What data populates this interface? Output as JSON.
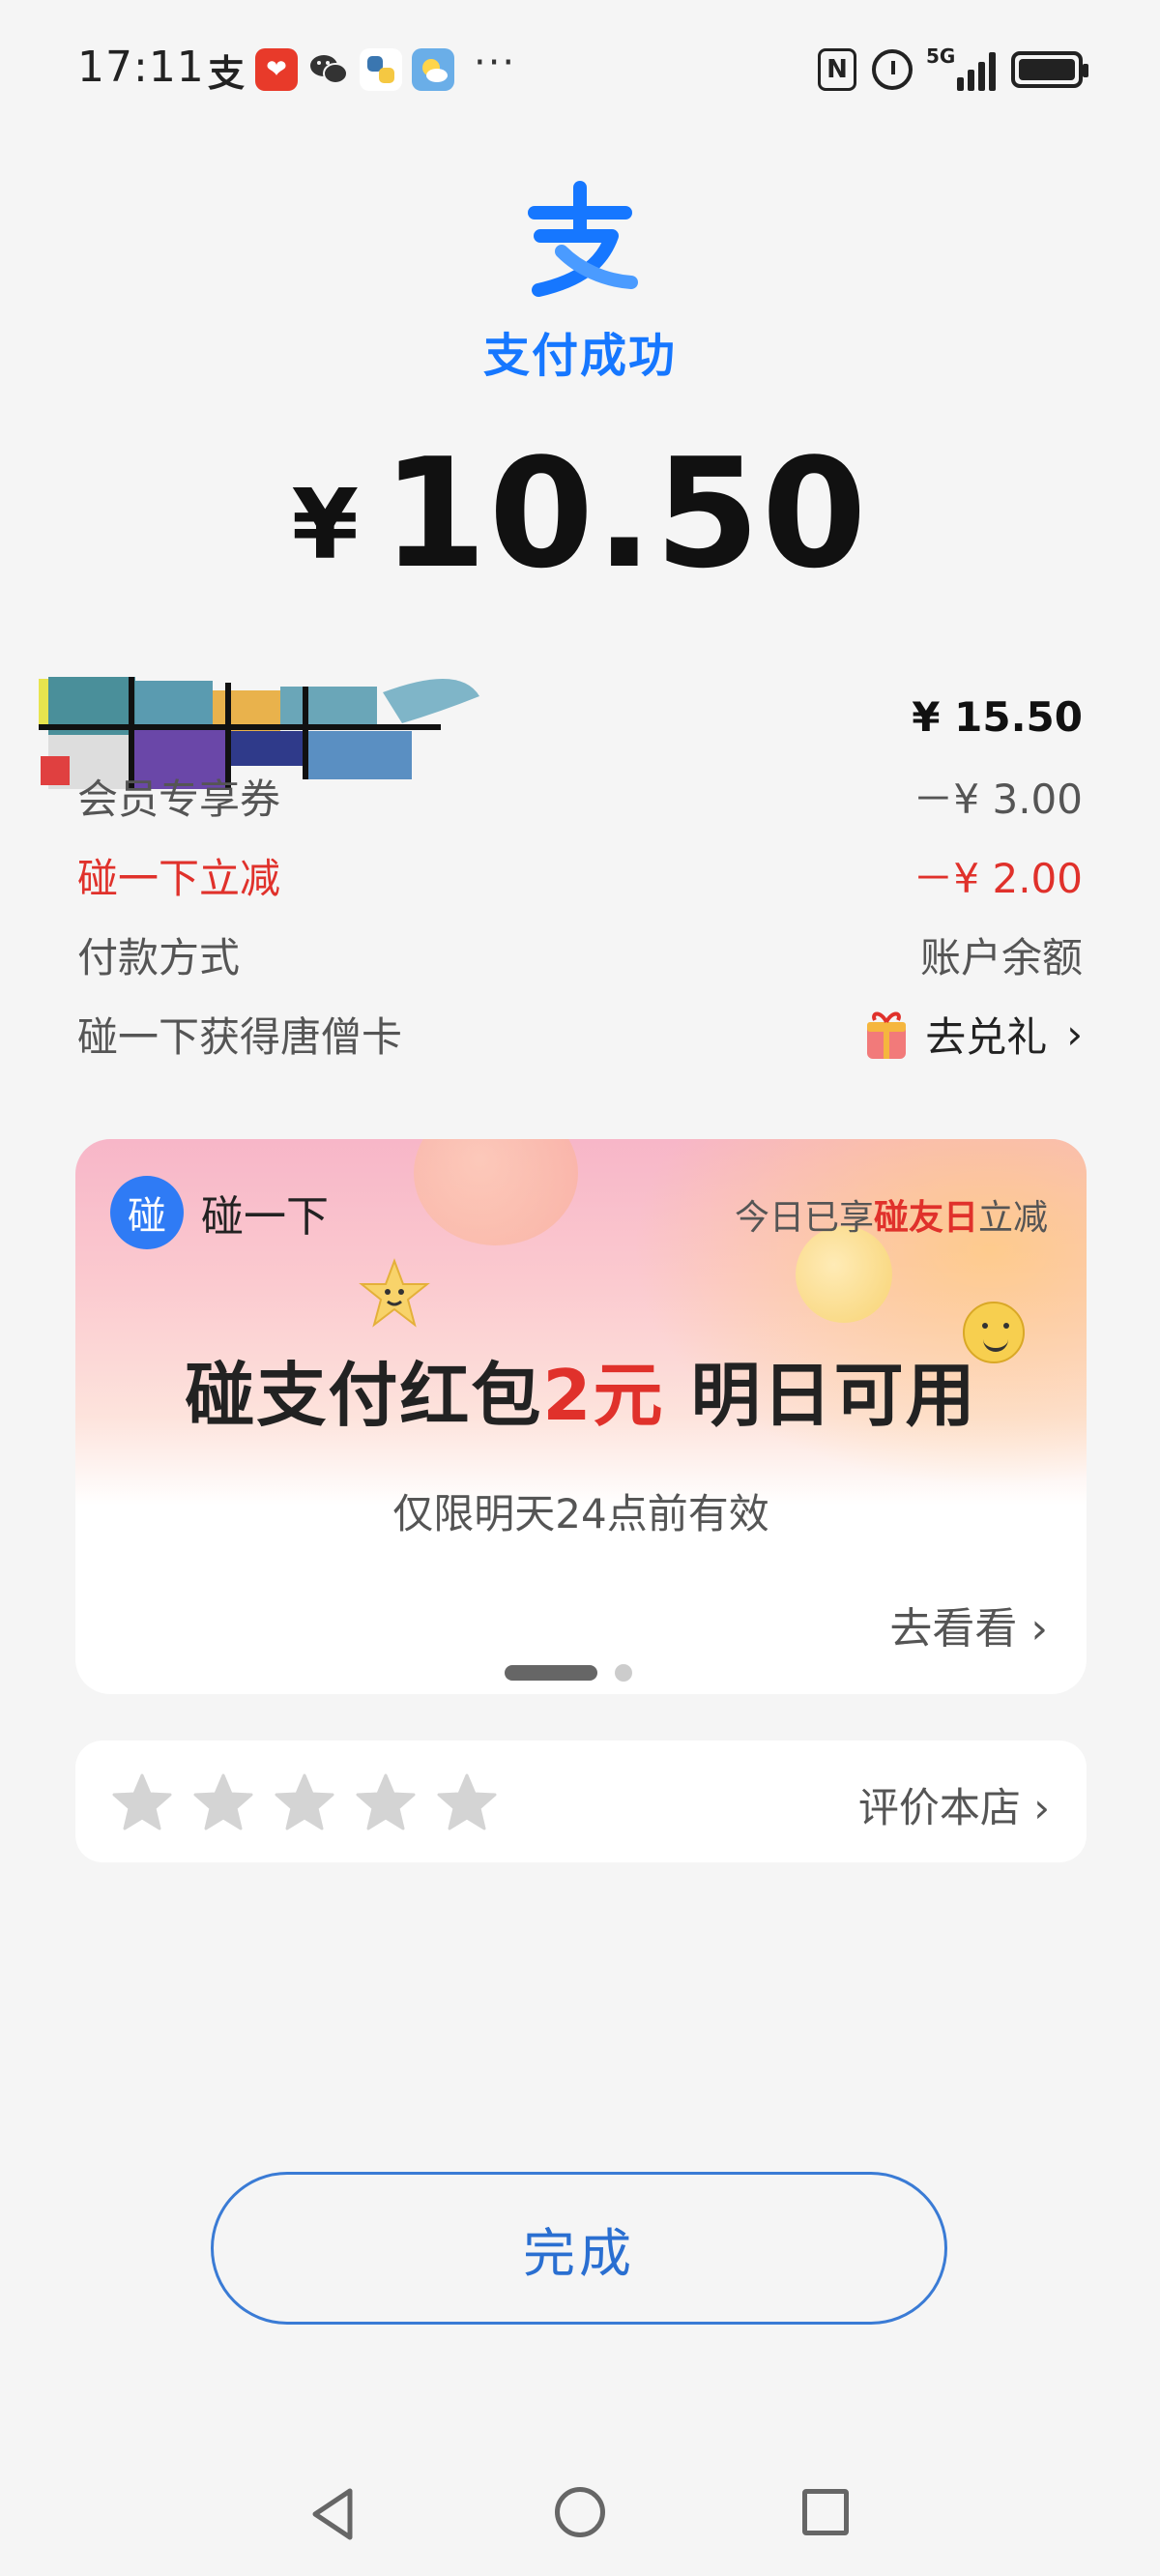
{
  "status_bar": {
    "time": "17:11",
    "app_icons": [
      "alipay-icon",
      "taobao-icon",
      "wechat-icon",
      "python-icon",
      "weather-icon"
    ],
    "more": "···",
    "nfc": "N",
    "network": "5G"
  },
  "header": {
    "logo_glyph": "支",
    "status": "支付成功",
    "currency": "¥",
    "amount": "10.50"
  },
  "details": {
    "total_value": "¥ 15.50",
    "coupon_label": "会员专享券",
    "coupon_value": "－¥ 3.00",
    "tap_discount_label": "碰一下立减",
    "tap_discount_value": "－¥ 2.00",
    "pay_method_label": "付款方式",
    "pay_method_value": "账户余额",
    "card_label": "碰一下获得唐僧卡",
    "card_action": "去兑礼"
  },
  "promo": {
    "badge_glyph": "碰",
    "brand": "碰一下",
    "right_prefix": "今日已享",
    "right_highlight": "碰友日",
    "right_suffix": "立减",
    "headline_prefix": "碰支付红包",
    "headline_amount": "2元",
    "headline_suffix": " 明日可用",
    "sub": "仅限明天24点前有效",
    "link": "去看看",
    "page_count": 2,
    "page_active": 1
  },
  "rating": {
    "star_count": 5,
    "link": "评价本店"
  },
  "done_button": "完成",
  "colors": {
    "accent_blue": "#1677ff",
    "discount_red": "#e0312b",
    "background": "#f5f5f5"
  }
}
